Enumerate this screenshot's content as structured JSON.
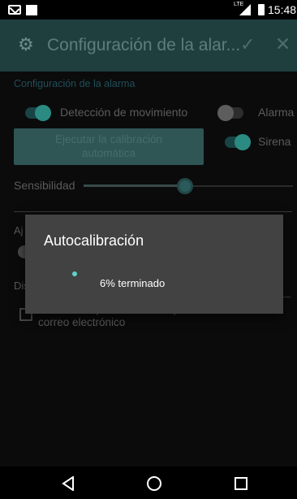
{
  "status_bar": {
    "network": "LTE",
    "time": "15:48"
  },
  "app_bar": {
    "title": "Configuración de la alar..."
  },
  "settings": {
    "section_title": "Configuración de la alarma",
    "motion_detection_label": "Detección de movimiento",
    "motion_detection_on": true,
    "alarm_label": "Alarma",
    "alarm_on": false,
    "calibrate_button_line1": "Ejecutar la calibración",
    "calibrate_button_line2": "automática",
    "siren_label": "Sirena",
    "siren_on": true,
    "sensitivity_label": "Sensibilidad",
    "sensitivity_value": 0.48,
    "partial_label_1": "Aj",
    "partial_label_2": "Dis",
    "email_option_label": "Enviar cualquier cambio de posición a través del correo electrónico",
    "email_option_checked": false
  },
  "dialog": {
    "title": "Autocalibración",
    "message": "6% terminado",
    "progress_percent": 6
  },
  "colors": {
    "accent": "#2b8b83",
    "app_bar": "#1f3f3f",
    "dialog_bg": "#424242"
  },
  "icons": {
    "app_bar_left": "gear-icon",
    "app_bar_confirm": "check-icon",
    "app_bar_close": "close-icon",
    "nav_back": "back-icon",
    "nav_home": "home-icon",
    "nav_recent": "recent-apps-icon"
  }
}
